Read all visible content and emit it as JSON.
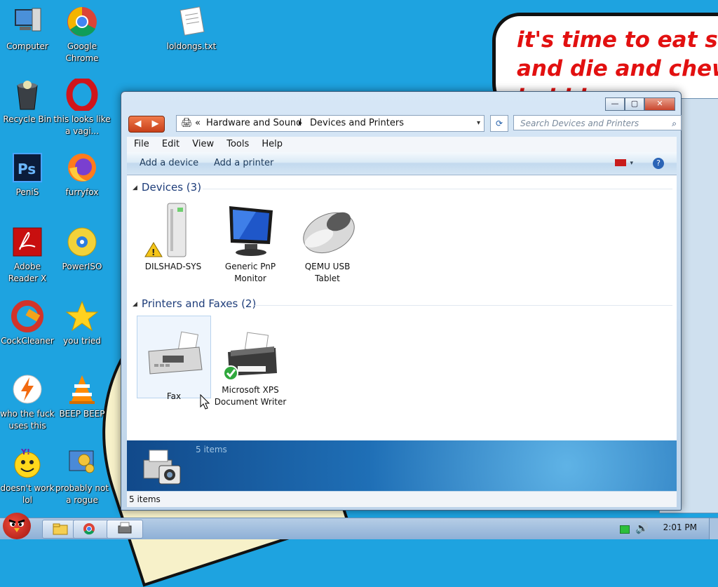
{
  "wallpaper": {
    "speech_text": "it's time to eat shit\nand die and chew\nbubble gum"
  },
  "desktop_icons": [
    {
      "label": "Computer"
    },
    {
      "label": "Google Chrome"
    },
    {
      "label": "loldongs.txt"
    },
    {
      "label": "Recycle Bin"
    },
    {
      "label": "this looks like a vagi..."
    },
    {
      "label": "PeniS"
    },
    {
      "label": "furryfox"
    },
    {
      "label": "Adobe Reader X"
    },
    {
      "label": "PowerISO"
    },
    {
      "label": "CockCleaner"
    },
    {
      "label": "you tried"
    },
    {
      "label": "who the fuck uses this"
    },
    {
      "label": "BEEP BEEP"
    },
    {
      "label": "doesn't work lol"
    },
    {
      "label": "probably not a rogue"
    }
  ],
  "window": {
    "caption": {
      "minimize": "—",
      "maximize": "▢",
      "close": "✕"
    },
    "nav": {
      "back": "◀",
      "forward": "▶"
    },
    "address": {
      "prefix": "«",
      "crumbs": [
        "Hardware and Sound",
        "Devices and Printers"
      ],
      "separator": "▸",
      "dropdown": "▾"
    },
    "search": {
      "placeholder": "Search Devices and Printers",
      "icon": "⌕"
    },
    "menu": [
      "File",
      "Edit",
      "View",
      "Tools",
      "Help"
    ],
    "commands": [
      "Add a device",
      "Add a printer"
    ],
    "help_label": "?",
    "groups": [
      {
        "title": "Devices (3)",
        "items": [
          {
            "label": "DILSHAD-SYS",
            "icon": "computer-tower-icon",
            "warning": true
          },
          {
            "label": "Generic PnP Monitor",
            "icon": "monitor-icon"
          },
          {
            "label": "QEMU USB Tablet",
            "icon": "mouse-icon"
          }
        ]
      },
      {
        "title": "Printers and Faxes (2)",
        "items": [
          {
            "label": "Fax",
            "icon": "fax-icon",
            "selected": true
          },
          {
            "label": "Microsoft XPS Document Writer",
            "icon": "printer-icon",
            "default": true
          }
        ]
      }
    ],
    "details_count": "5 items",
    "status": "5 items"
  },
  "taskbar": {
    "clock": "2:01 PM"
  }
}
